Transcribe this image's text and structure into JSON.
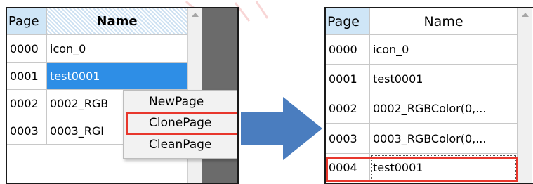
{
  "left": {
    "headers": {
      "page": "Page",
      "name": "Name"
    },
    "rows": [
      {
        "page": "0000",
        "name": "icon_0"
      },
      {
        "page": "0001",
        "name": "test0001"
      },
      {
        "page": "0002",
        "name": "0002_RGB"
      },
      {
        "page": "0003",
        "name": "0003_RGI"
      }
    ],
    "selected_index": 1,
    "context_menu": {
      "items": [
        "NewPage",
        "ClonePage",
        "CleanPage"
      ],
      "highlighted_item": "ClonePage"
    }
  },
  "right": {
    "headers": {
      "page": "Page",
      "name": "Name"
    },
    "rows": [
      {
        "page": "0000",
        "name": "icon_0"
      },
      {
        "page": "0001",
        "name": "test0001"
      },
      {
        "page": "0002",
        "name": "0002_RGBColor(0,..."
      },
      {
        "page": "0003",
        "name": "0003_RGBColor(0,..."
      },
      {
        "page": "0004",
        "name": "test0001"
      }
    ],
    "highlighted_row_index": 4
  },
  "colors": {
    "highlight": "#e8372d",
    "selection": "#2e8ee6",
    "arrow": "#4a7dbf"
  }
}
